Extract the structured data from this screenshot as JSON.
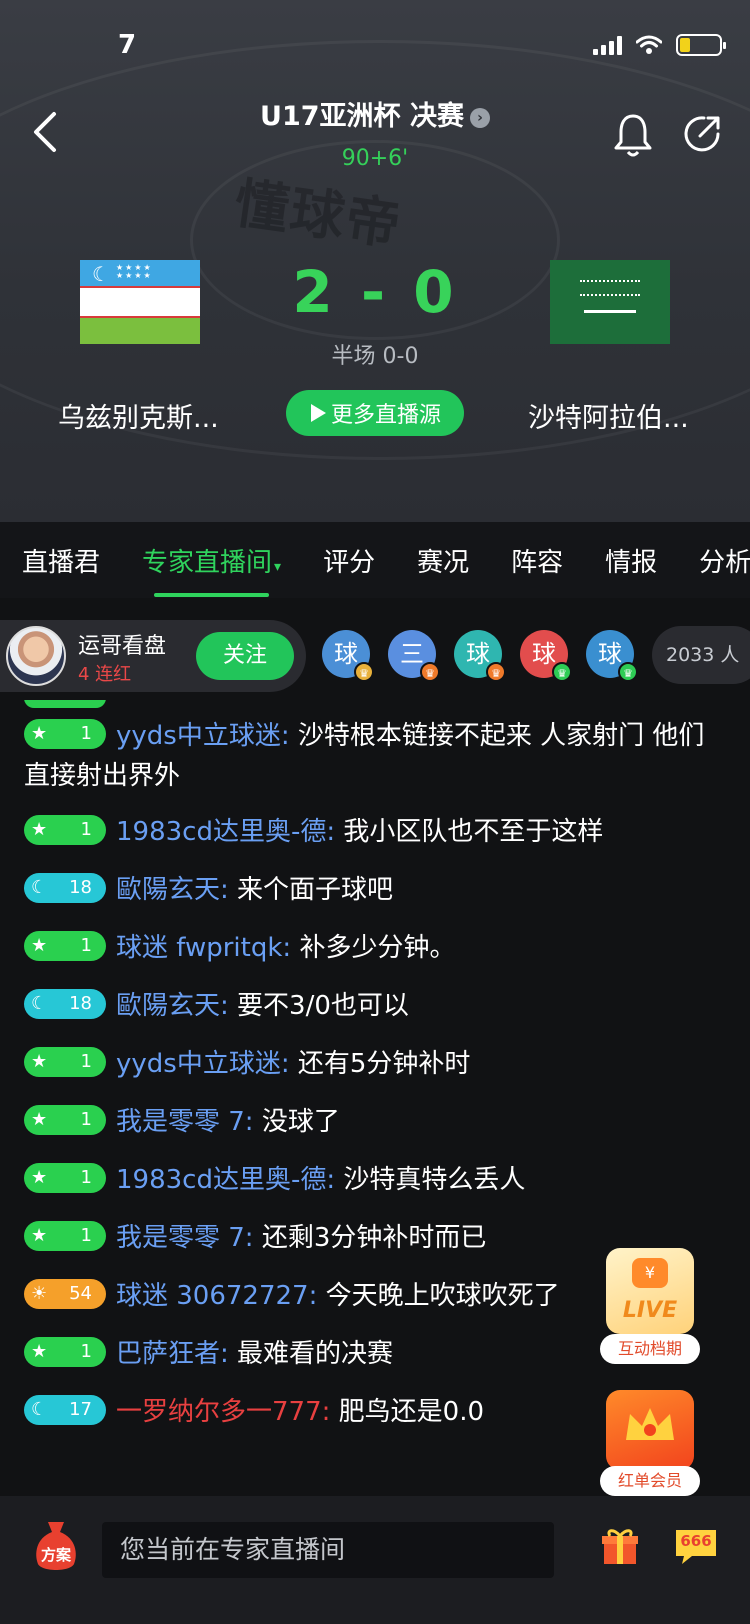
{
  "status_bar": {
    "time": "7"
  },
  "match": {
    "title": "U17亚洲杯 决赛",
    "minute": "90+6'",
    "watermark": "懂球帝",
    "home_team": "乌兹别克斯...",
    "away_team": "沙特阿拉伯...",
    "score": "2 - 0",
    "halftime": "半场 0-0",
    "more_sources": "更多直播源"
  },
  "tabs": [
    "直播君",
    "专家直播间",
    "评分",
    "赛况",
    "阵容",
    "情报",
    "分析"
  ],
  "expert": {
    "name": "运哥看盘",
    "streak": "4 连红",
    "follow": "关注",
    "viewers": [
      {
        "label": "球",
        "color": "#4b8fd6",
        "badge_color": "#e8b03b"
      },
      {
        "label": "三",
        "color": "#5a8fe0",
        "badge_color": "#f07a2a"
      },
      {
        "label": "球",
        "color": "#2fb6b0",
        "badge_color": "#f07a2a"
      },
      {
        "label": "球",
        "color": "#e24d4d",
        "badge_color": "#2ecc55"
      },
      {
        "label": "球",
        "color": "#3a8fd0",
        "badge_color": "#2ecc55"
      }
    ],
    "viewer_count": "2033 人"
  },
  "messages": [
    {
      "level": "1",
      "type": "green",
      "icon": "★",
      "user": "yyds中立球迷:",
      "text": "沙特根本链接不起来 人家射门 他们直接射出界外",
      "red": false
    },
    {
      "level": "1",
      "type": "green",
      "icon": "★",
      "user": "1983cd达里奥-德:",
      "text": "我小区队也不至于这样",
      "red": false
    },
    {
      "level": "18",
      "type": "cyan",
      "icon": "☾",
      "user": "歐陽玄天:",
      "text": "来个面子球吧",
      "red": false
    },
    {
      "level": "1",
      "type": "green",
      "icon": "★",
      "user": "球迷 fwpritqk:",
      "text": "补多少分钟。",
      "red": false
    },
    {
      "level": "18",
      "type": "cyan",
      "icon": "☾",
      "user": "歐陽玄天:",
      "text": "要不3/0也可以",
      "red": false
    },
    {
      "level": "1",
      "type": "green",
      "icon": "★",
      "user": "yyds中立球迷:",
      "text": "还有5分钟补时",
      "red": false
    },
    {
      "level": "1",
      "type": "green",
      "icon": "★",
      "user": "我是零零 7:",
      "text": "没球了",
      "red": false
    },
    {
      "level": "1",
      "type": "green",
      "icon": "★",
      "user": "1983cd达里奥-德:",
      "text": "沙特真特么丢人",
      "red": false
    },
    {
      "level": "1",
      "type": "green",
      "icon": "★",
      "user": "我是零零 7:",
      "text": "还剩3分钟补时而已",
      "red": false
    },
    {
      "level": "54",
      "type": "orange",
      "icon": "☀",
      "user": "球迷 30672727:",
      "text": "今天晚上吹球吹死了",
      "red": false
    },
    {
      "level": "1",
      "type": "green",
      "icon": "★",
      "user": "巴萨狂者:",
      "text": "最难看的决赛",
      "red": false
    },
    {
      "level": "17",
      "type": "cyan",
      "icon": "☾",
      "user": "一罗纳尔多一777:",
      "text": "肥鸟还是0.0",
      "red": true
    }
  ],
  "floats": {
    "live_text": "LIVE",
    "live_label": "互动档期",
    "vip_label": "红单会员"
  },
  "bottom": {
    "plan_label": "方案",
    "input_placeholder": "您当前在专家直播间",
    "chat_badge": "666"
  }
}
